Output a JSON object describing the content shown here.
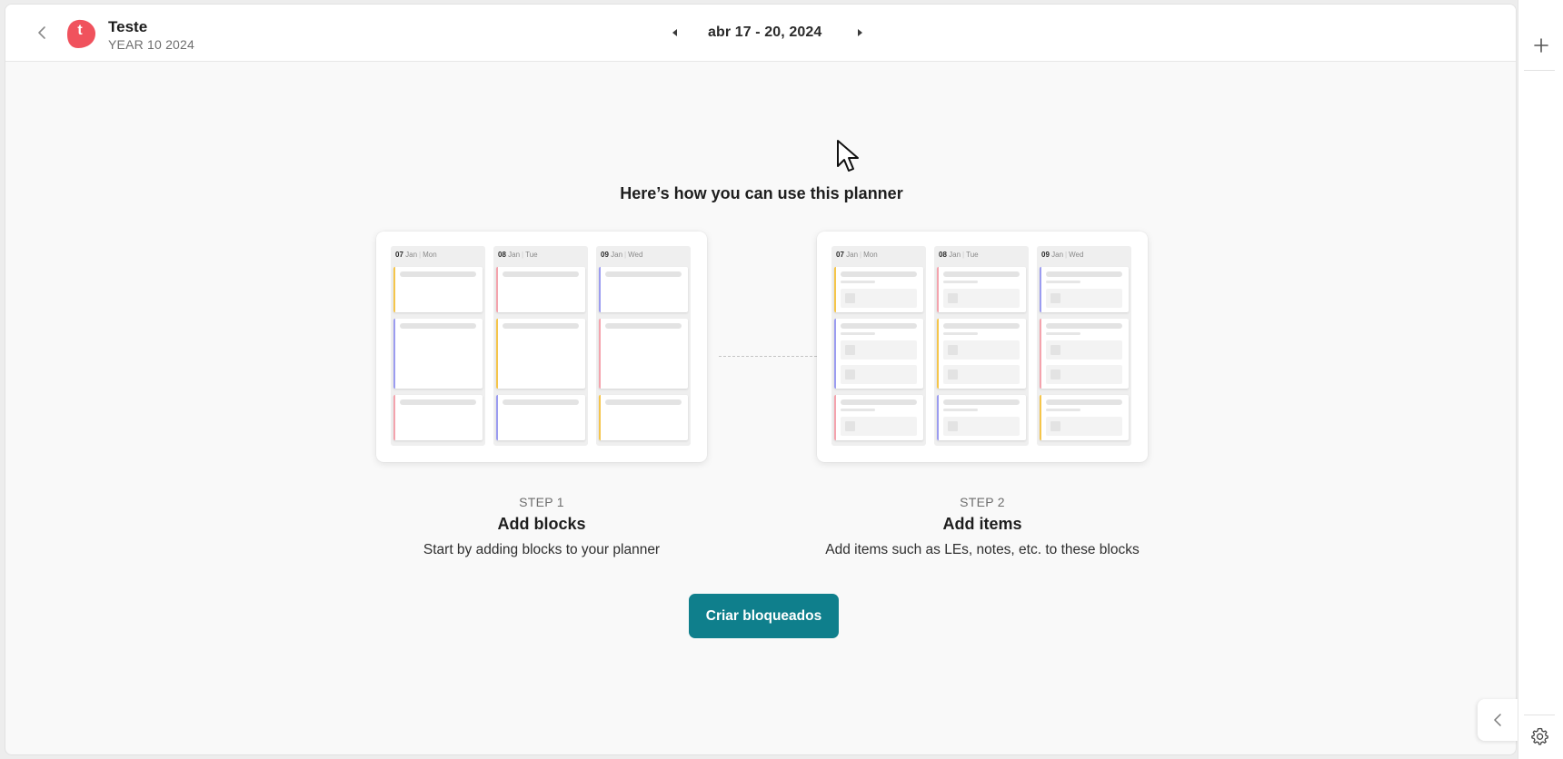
{
  "header": {
    "title": "Teste",
    "subtitle": "YEAR 10 2024",
    "avatar_letter": "t",
    "date_range": "abr 17 - 20, 2024"
  },
  "intro": {
    "title": "Here’s how you can use this planner",
    "preview_columns": [
      {
        "day": "07",
        "month": "Jan",
        "weekday": "Mon"
      },
      {
        "day": "08",
        "month": "Jan",
        "weekday": "Tue"
      },
      {
        "day": "09",
        "month": "Jan",
        "weekday": "Wed"
      }
    ],
    "steps": [
      {
        "label": "STEP 1",
        "title": "Add blocks",
        "description": "Start by adding blocks to your planner"
      },
      {
        "label": "STEP 2",
        "title": "Add items",
        "description": "Add items such as LEs, notes, etc. to these blocks"
      }
    ],
    "cta_label": "Criar bloqueados"
  },
  "icons": {
    "back": "chevron-left-icon",
    "prev": "caret-left-icon",
    "next": "caret-right-icon",
    "add": "plus-icon",
    "settings": "gear-icon",
    "collapse": "chevron-left-icon"
  },
  "colors": {
    "accent": "#0f7f8c",
    "avatar": "#f0525d",
    "block_yellow": "#f5c54a",
    "block_purple": "#9b9cf0",
    "block_pink": "#f4a3ad"
  }
}
